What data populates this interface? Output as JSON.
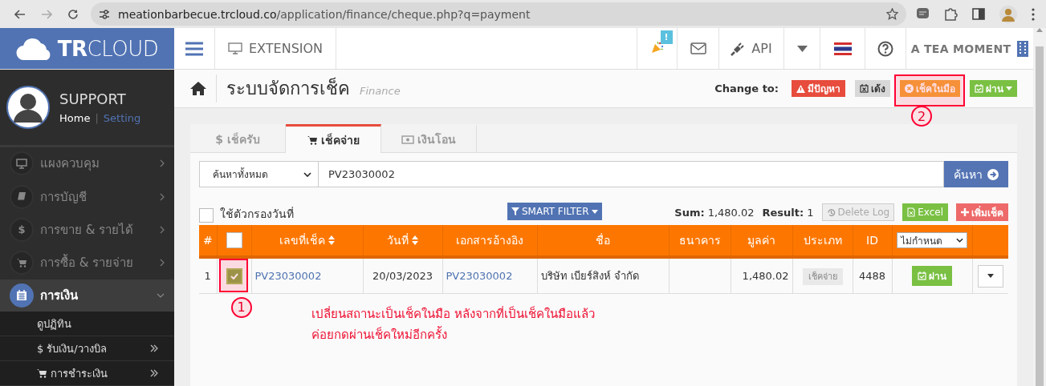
{
  "browser": {
    "url_host": "meationbarbecue.trcloud.co",
    "url_path": "/application/finance/cheque.php?q=payment"
  },
  "header": {
    "logo": "**TR**CLOUD",
    "extension": "EXTENSION",
    "notification_badge": "!",
    "api": "API",
    "company": "A TEA MOMENT"
  },
  "sidebar": {
    "user": "SUPPORT",
    "home_link": "Home",
    "link_separator": "|",
    "setting_link": "Setting",
    "items": [
      {
        "label": "แผงควบคุม",
        "selected": false,
        "expanded": false
      },
      {
        "label": "การบัญชี",
        "selected": false,
        "expanded": false
      },
      {
        "label": "การขาย & รายได้",
        "glyph": "$",
        "selected": false,
        "expanded": false
      },
      {
        "label": "การซื้อ & รายจ่าย",
        "selected": false,
        "expanded": false
      },
      {
        "label": "การเงิน",
        "selected": true,
        "expanded": true,
        "children": [
          {
            "label": "ดูปฏิทิน",
            "has_submenu": false
          },
          {
            "label": "รับเงิน/วางบิล",
            "glyph": "$",
            "has_submenu": true
          },
          {
            "label": "การชำระเงิน",
            "has_submenu": true
          }
        ]
      }
    ]
  },
  "page": {
    "title": "ระบบจัดการเช็ค",
    "subtitle": "Finance",
    "change_to_label": "Change to:",
    "status_buttons": [
      {
        "label": "มีปัญหา",
        "kind": "danger",
        "caret": false
      },
      {
        "label": "เด้ง",
        "kind": "default",
        "caret": false
      },
      {
        "label": "เช็คในมือ",
        "kind": "warning",
        "caret": false,
        "marker": "2"
      },
      {
        "label": "ผ่าน",
        "kind": "success",
        "caret": true
      }
    ]
  },
  "tabs": [
    {
      "label": "$ เช็ครับ",
      "selected": false
    },
    {
      "label": "เช็คจ่าย",
      "selected": true
    },
    {
      "label": "เงินโอน",
      "selected": false
    }
  ],
  "search": {
    "scope": "ค้นหาทั้งหมด",
    "value": "PV23030002",
    "button": "ค้นหา"
  },
  "filter": {
    "date_filter_label": "ใช้ตัวกรองวันที่",
    "date_filter_checked": false,
    "smart_filter": "SMART FILTER",
    "sum_label": "Sum:",
    "sum": "1,480.02",
    "result_label": "Result:",
    "result": "1",
    "delete_log": "Delete Log",
    "excel": "Excel",
    "add": "เพิ่มเช็ค"
  },
  "table": {
    "header_checked": false,
    "status_filter": "ไม่กำหนด",
    "columns": [
      {
        "label": "#",
        "sortable": false
      },
      {
        "label": "เลขที่เช็ค",
        "sortable": true
      },
      {
        "label": "วันที่",
        "sortable": true
      },
      {
        "label": "เอกสารอ้างอิง",
        "sortable": false
      },
      {
        "label": "ชื่อ",
        "sortable": false
      },
      {
        "label": "ธนาคาร",
        "sortable": false
      },
      {
        "label": "มูลค่า",
        "sortable": false
      },
      {
        "label": "ประเภท",
        "sortable": false
      },
      {
        "label": "ID",
        "sortable": false
      }
    ],
    "rows": [
      {
        "index": "1",
        "selected": true,
        "marker": "1",
        "cheque_no": "PV23030002",
        "date": "20/03/2023",
        "reference": "PV23030002",
        "name": "บริษัท เบียร์สิงห์ จำกัด",
        "amount": "1,480.02",
        "type": "เช็คจ่าย",
        "id": "4488",
        "status": "ผ่าน"
      }
    ]
  },
  "note": [
    "เปลี่ยนสถานะเป็นเช็คในมือ หลังจากที่เป็นเช็คในมือแล้ว",
    "ค่อยกดผ่านเช็คใหม่อีกครั้ง"
  ]
}
